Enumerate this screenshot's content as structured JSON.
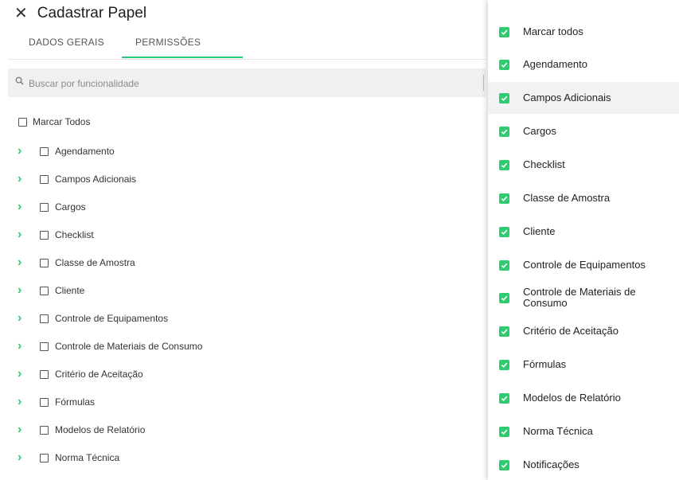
{
  "header": {
    "title": "Cadastrar Papel",
    "close_icon": "close-icon"
  },
  "tabs": [
    {
      "label": "DADOS GERAIS",
      "active": false
    },
    {
      "label": "PERMISSÕES",
      "active": true
    }
  ],
  "search": {
    "placeholder": "Buscar por funcionalidade",
    "value": ""
  },
  "mark_all_label": "Marcar Todos",
  "permissions": [
    "Agendamento",
    "Campos Adicionais",
    "Cargos",
    "Checklist",
    "Classe de Amostra",
    "Cliente",
    "Controle de Equipamentos",
    "Controle de Materiais de Consumo",
    "Critério de Aceitação",
    "Fórmulas",
    "Modelos de Relatório",
    "Norma Técnica"
  ],
  "dropdown": {
    "highlighted_index": 2,
    "items": [
      {
        "label": "Marcar todos",
        "checked": true
      },
      {
        "label": "Agendamento",
        "checked": true
      },
      {
        "label": "Campos Adicionais",
        "checked": true
      },
      {
        "label": "Cargos",
        "checked": true
      },
      {
        "label": "Checklist",
        "checked": true
      },
      {
        "label": "Classe de Amostra",
        "checked": true
      },
      {
        "label": "Cliente",
        "checked": true
      },
      {
        "label": "Controle de Equipamentos",
        "checked": true
      },
      {
        "label": "Controle de Materiais de Consumo",
        "checked": true
      },
      {
        "label": "Critério de Aceitação",
        "checked": true
      },
      {
        "label": "Fórmulas",
        "checked": true
      },
      {
        "label": "Modelos de Relatório",
        "checked": true
      },
      {
        "label": "Norma Técnica",
        "checked": true
      },
      {
        "label": "Notificações",
        "checked": true
      }
    ]
  },
  "colors": {
    "accent": "#2ecc71",
    "search_bg": "#f0f0f0",
    "highlight": "#f2f2f2"
  }
}
